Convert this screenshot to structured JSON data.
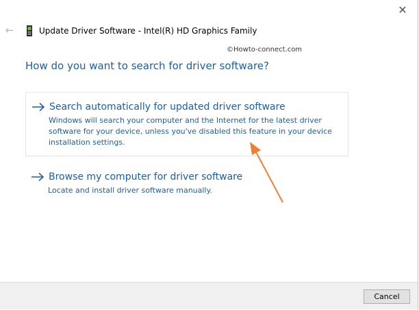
{
  "dialog": {
    "title": "Update Driver Software - Intel(R) HD Graphics Family",
    "close_glyph": "✕",
    "back_glyph": "←",
    "watermark": "©Howto-connect.com",
    "heading": "How do you want to search for driver software?"
  },
  "options": [
    {
      "title": "Search automatically for updated driver software",
      "description": "Windows will search your computer and the Internet for the latest driver software for your device, unless you've disabled this feature in your device installation settings."
    },
    {
      "title": "Browse my computer for driver software",
      "description": "Locate and install driver software manually."
    }
  ],
  "footer": {
    "cancel_label": "Cancel"
  },
  "icons": {
    "device": "graphics-card-icon",
    "option_arrow": "right-arrow-icon",
    "annotation": "orange-arrow-annotation"
  },
  "colors": {
    "link_blue": "#1b5ea8",
    "annotation_orange": "#f07f35",
    "footer_bg": "#f0f0f0"
  }
}
